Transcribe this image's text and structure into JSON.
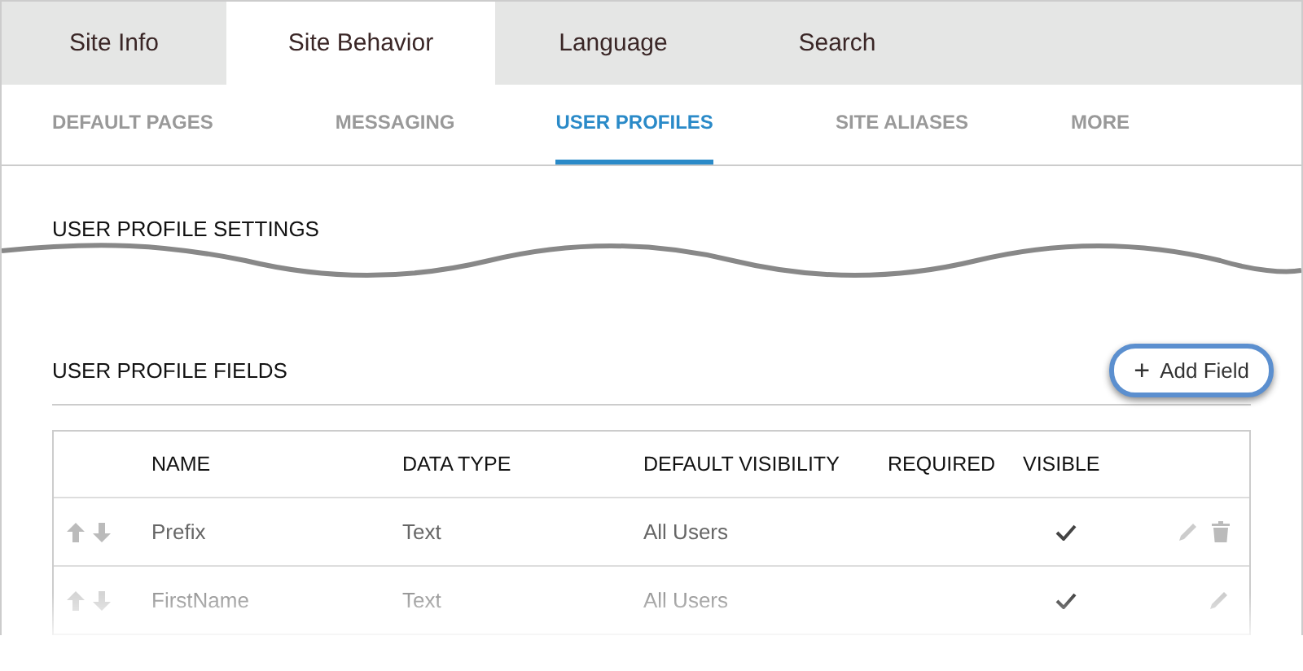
{
  "tabs": [
    {
      "label": "Site Info",
      "selected": false
    },
    {
      "label": "Site Behavior",
      "selected": true
    },
    {
      "label": "Language",
      "selected": false
    },
    {
      "label": "Search",
      "selected": false
    }
  ],
  "subtabs": [
    {
      "label": "DEFAULT PAGES",
      "selected": false
    },
    {
      "label": "MESSAGING",
      "selected": false
    },
    {
      "label": "USER PROFILES",
      "selected": true
    },
    {
      "label": "SITE ALIASES",
      "selected": false
    },
    {
      "label": "MORE",
      "selected": false
    }
  ],
  "settings_section": {
    "title": "USER PROFILE SETTINGS"
  },
  "fields_section": {
    "title": "USER PROFILE FIELDS",
    "add_button": {
      "icon": "+",
      "label": "Add Field",
      "highlighted": true
    }
  },
  "table": {
    "columns": [
      "NAME",
      "DATA TYPE",
      "DEFAULT VISIBILITY",
      "REQUIRED",
      "VISIBLE"
    ],
    "rows": [
      {
        "name": "Prefix",
        "data_type": "Text",
        "default_visibility": "All Users",
        "visible": true,
        "hovered": true
      },
      {
        "name": "FirstName",
        "data_type": "Text",
        "default_visibility": "All Users",
        "visible": true,
        "hovered": false
      }
    ]
  }
}
